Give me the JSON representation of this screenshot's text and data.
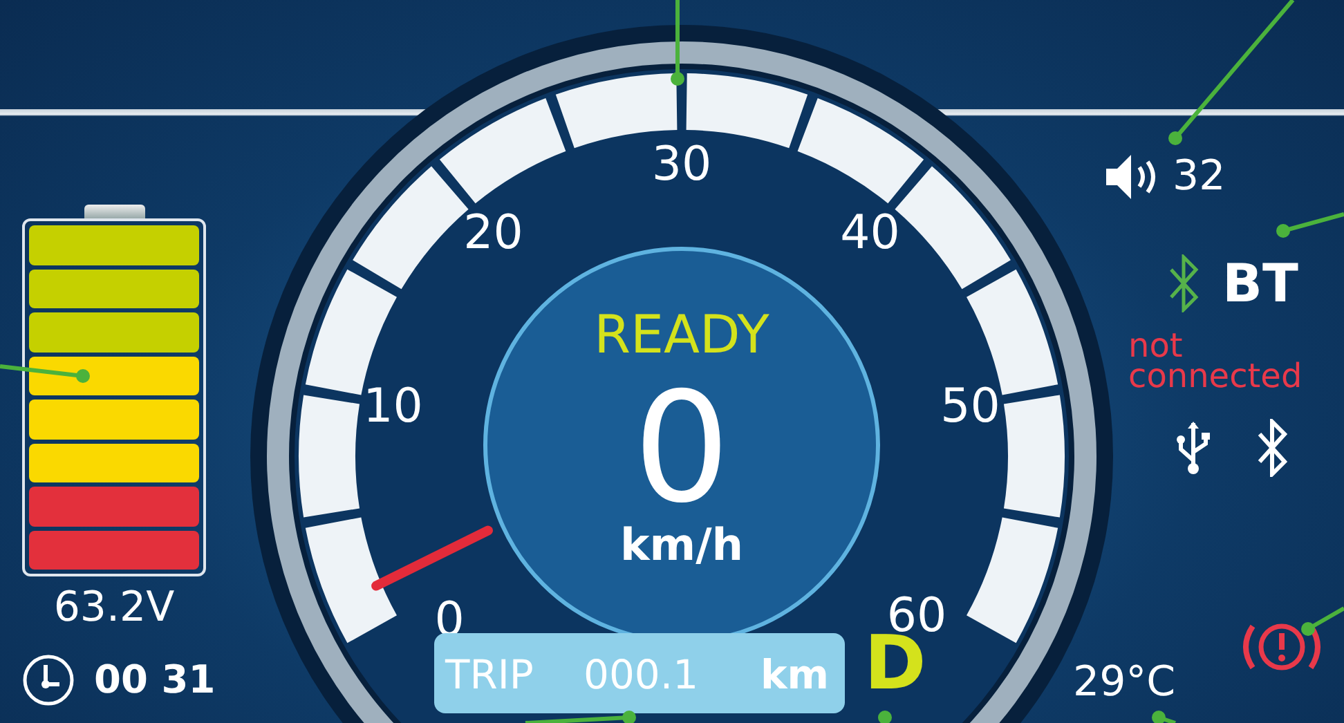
{
  "battery": {
    "segments": [
      {
        "color": "#c5d000"
      },
      {
        "color": "#c5d000"
      },
      {
        "color": "#c5d000"
      },
      {
        "color": "#fad900"
      },
      {
        "color": "#fad900"
      },
      {
        "color": "#fad900"
      },
      {
        "color": "#e3303c"
      },
      {
        "color": "#e3303c"
      }
    ],
    "voltage": "63.2V"
  },
  "clock": {
    "time": "00 31"
  },
  "speedometer": {
    "scale_labels": [
      "0",
      "10",
      "20",
      "30",
      "40",
      "50",
      "60"
    ],
    "status": "READY",
    "speed": "0",
    "unit": "km/h"
  },
  "trip": {
    "label": "TRIP",
    "value": "000.1",
    "unit": "km"
  },
  "gear": "D",
  "volume": {
    "value": "32"
  },
  "bluetooth": {
    "label": "BT",
    "status": "not connected"
  },
  "temperature": "29°C"
}
